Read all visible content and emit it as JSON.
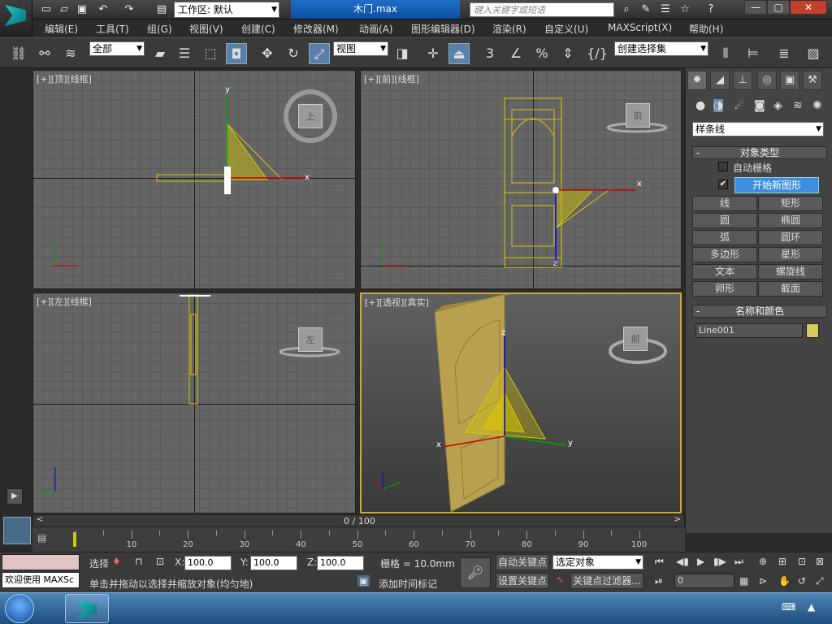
{
  "titlebar": {
    "workspace_label": "工作区: 默认",
    "file_title": "木门.max",
    "search_placeholder": "键入关键字或短语"
  },
  "menus": [
    "编辑(E)",
    "工具(T)",
    "组(G)",
    "视图(V)",
    "创建(C)",
    "修改器(M)",
    "动画(A)",
    "图形编辑器(D)",
    "渲染(R)",
    "自定义(U)",
    "MAXScript(X)",
    "帮助(H)"
  ],
  "toolbar": {
    "selection_filter": "全部",
    "ref_coord": "视图",
    "named_selection": "创建选择集",
    "snap_label": "3"
  },
  "viewports": {
    "top_label": "[+][顶][线框]",
    "front_label": "[+][前][线框]",
    "left_label": "[+][左][线框]",
    "persp_label": "[+][透视][真实]",
    "cube_top": "上",
    "cube_front": "前",
    "cube_left": "左",
    "cube_persp": "前",
    "axis_x": "x",
    "axis_y": "y",
    "axis_z": "z"
  },
  "command_panel": {
    "category": "样条线",
    "object_type_title": "对象类型",
    "autogrid_label": "自动栅格",
    "start_new_shape_label": "开始新图形",
    "object_buttons": [
      "线",
      "矩形",
      "圆",
      "椭圆",
      "弧",
      "圆环",
      "多边形",
      "星形",
      "文本",
      "螺旋线",
      "卵形",
      "截面"
    ],
    "name_color_title": "名称和颜色",
    "object_name": "Line001",
    "object_color": "#d8c860"
  },
  "timeline": {
    "frame_counter": "0 / 100",
    "ticks": [
      "10",
      "20",
      "30",
      "40",
      "50",
      "60",
      "70",
      "80",
      "90",
      "100"
    ]
  },
  "status": {
    "welcome": "欢迎使用 MAXSc",
    "select_label": "选择",
    "x_value": "100.0",
    "y_value": "100.0",
    "z_value": "100.0",
    "grid_label": "栅格 = 10.0mm",
    "prompt": "单击并拖动以选择并缩放对象(均匀地)",
    "add_time_tag": "添加时间标记",
    "auto_key": "自动关键点",
    "set_key": "设置关键点",
    "selected_object": "选定对象",
    "key_filters": "关键点过滤器...",
    "current_frame": "0",
    "x_label": "X:",
    "y_label": "Y:",
    "z_label": "Z:"
  },
  "colors": {
    "accent_blue": "#0d4f9f",
    "wire_yellow": "#d8c800",
    "door_gold": "#b8a050",
    "active_border": "#c8a93a"
  }
}
